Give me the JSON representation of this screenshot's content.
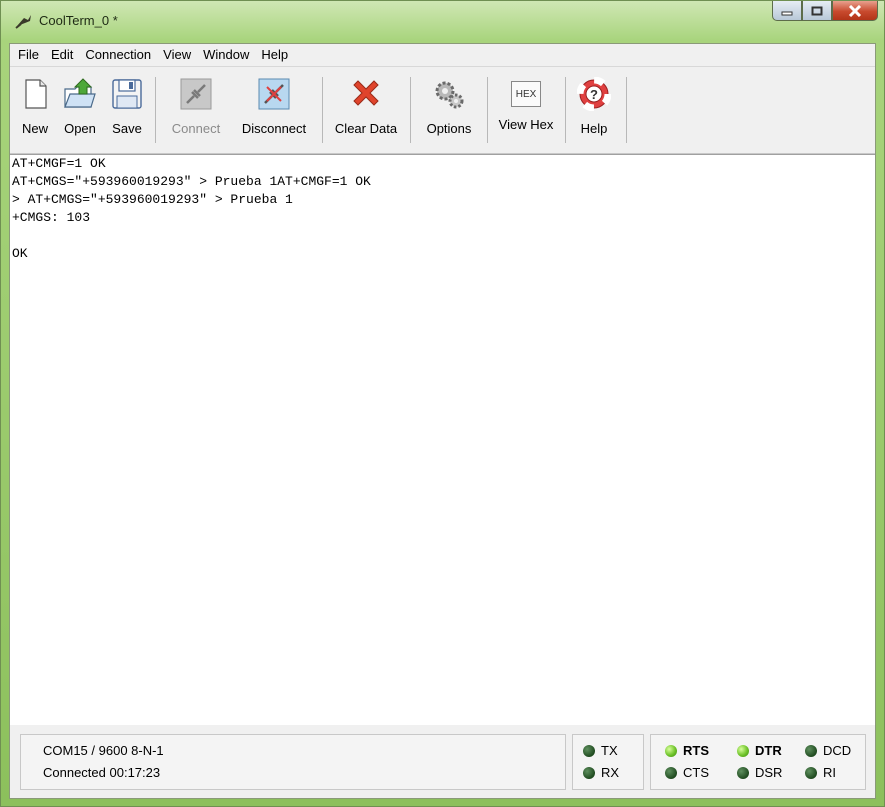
{
  "window": {
    "title": "CoolTerm_0 *"
  },
  "menu": [
    "File",
    "Edit",
    "Connection",
    "View",
    "Window",
    "Help"
  ],
  "toolbar": {
    "new": "New",
    "open": "Open",
    "save": "Save",
    "connect": "Connect",
    "disconnect": "Disconnect",
    "clear": "Clear Data",
    "options": "Options",
    "viewhex": "View Hex",
    "help": "Help",
    "hex_icon_text": "HEX"
  },
  "terminal": {
    "lines": [
      "AT+CMGF=1 OK",
      "AT+CMGS=\"+593960019293\" > Prueba 1AT+CMGF=1 OK",
      "> AT+CMGS=\"+593960019293\" > Prueba 1",
      "+CMGS: 103",
      "",
      "OK"
    ]
  },
  "status": {
    "port": "COM15 / 9600 8-N-1",
    "connection": "Connected 00:17:23"
  },
  "leds": {
    "tx": "TX",
    "rx": "RX",
    "rts": "RTS",
    "cts": "CTS",
    "dtr": "DTR",
    "dsr": "DSR",
    "dcd": "DCD",
    "ri": "RI"
  },
  "colors": {
    "led_on": "#6fc32a",
    "led_off": "#1f4a1f",
    "window_frame": "#a8d47c"
  }
}
